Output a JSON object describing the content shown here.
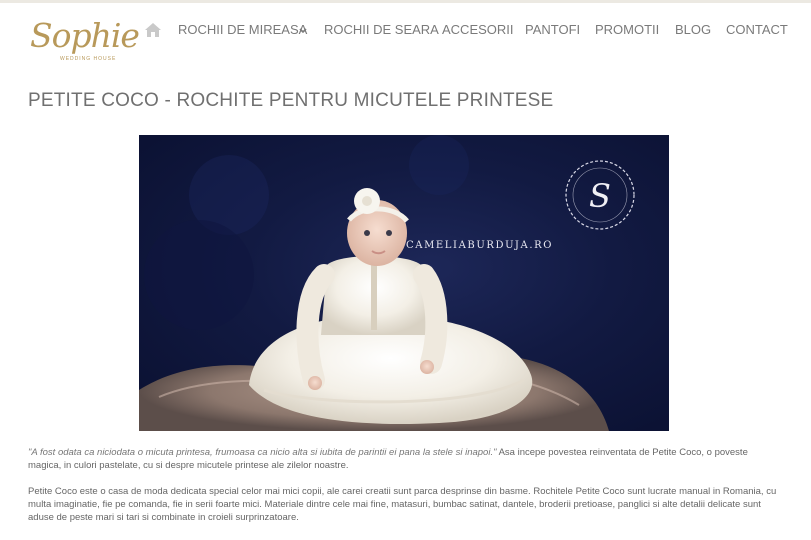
{
  "brand": {
    "name": "Sophie",
    "tagline": "WEDDING HOUSE"
  },
  "nav": {
    "home_icon": "home-icon",
    "items": [
      {
        "label": "ROCHII DE MIREASA",
        "has_dropdown": true
      },
      {
        "label": "ROCHII DE SEARA"
      },
      {
        "label": "ACCESORII"
      },
      {
        "label": "PANTOFI"
      },
      {
        "label": "PROMOTII"
      },
      {
        "label": "BLOG"
      },
      {
        "label": "CONTACT"
      }
    ]
  },
  "page": {
    "title": "PETITE COCO - ROCHITE PENTRU MICUTELE PRINTESE"
  },
  "hero_image": {
    "watermark_text": "CAMELIABURDUJA.RO",
    "watermark_logo_letter": "S"
  },
  "article": {
    "p1_quote": "\"A fost odata ca niciodata o micuta printesa, frumoasa ca nicio alta si iubita de parintii ei pana la stele si inapoi.\"",
    "p1_rest": " Asa incepe povestea reinventata de Petite Coco, o poveste magica, in culori pastelate, cu si despre micutele printese ale zilelor noastre.",
    "p2": "Petite Coco este o casa de moda dedicata special celor mai mici copii, ale carei creatii sunt parca desprinse din basme. Rochitele Petite Coco sunt lucrate manual in Romania, cu multa imaginatie, fie pe comanda, fie in serii foarte mici. Materiale dintre cele mai fine, matasuri, bumbac satinat, dantele, broderii pretioase, panglici si alte detalii delicate sunt aduse de peste mari si tari si combinate in croieli surprinzatoare."
  },
  "colors": {
    "brand_gold": "#b8995a",
    "nav_text": "#7a7a7a",
    "title_text": "#707070",
    "photo_background": "#121a42"
  }
}
